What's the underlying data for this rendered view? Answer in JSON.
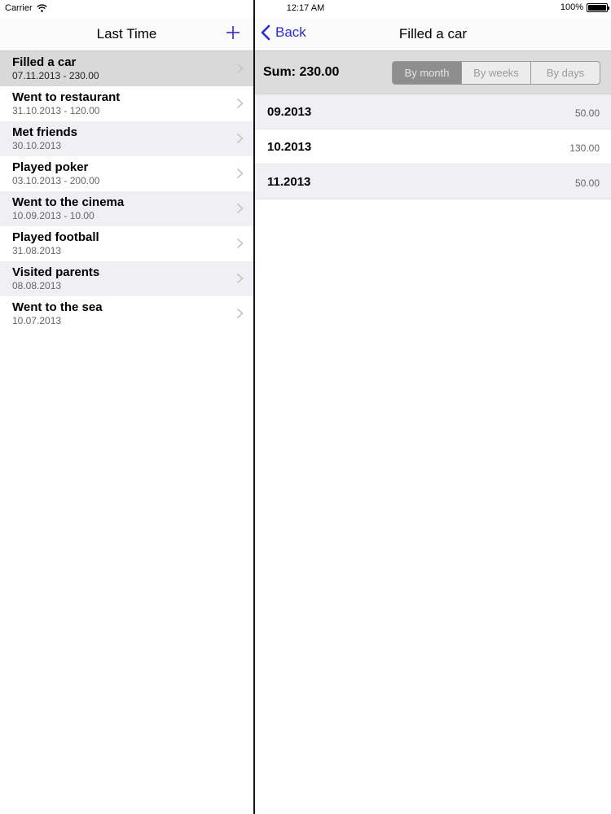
{
  "status": {
    "carrier": "Carrier",
    "time": "12:17 AM",
    "battery": "100%"
  },
  "master": {
    "title": "Last Time",
    "items": [
      {
        "title": "Filled a car",
        "subtitle": "07.11.2013 - 230.00"
      },
      {
        "title": "Went to restaurant",
        "subtitle": "31.10.2013 - 120.00"
      },
      {
        "title": "Met friends",
        "subtitle": "30.10.2013"
      },
      {
        "title": "Played poker",
        "subtitle": "03.10.2013 - 200.00"
      },
      {
        "title": "Went to the cinema",
        "subtitle": "10.09.2013 - 10.00"
      },
      {
        "title": "Played football",
        "subtitle": "31.08.2013"
      },
      {
        "title": "Visited parents",
        "subtitle": "08.08.2013"
      },
      {
        "title": "Went to the sea",
        "subtitle": "10.07.2013"
      }
    ]
  },
  "detail": {
    "back_label": "Back",
    "title": "Filled a car",
    "sum": "Sum: 230.00",
    "segments": [
      "By month",
      "By weeks",
      "By days"
    ],
    "active_segment": "By month",
    "rows": [
      {
        "period": "09.2013",
        "amount": "50.00"
      },
      {
        "period": "10.2013",
        "amount": "130.00"
      },
      {
        "period": "11.2013",
        "amount": "50.00"
      }
    ]
  },
  "colors": {
    "tint": "#2b2bd4",
    "selected_row": "#d9d9d9",
    "alt_row": "#efeff4",
    "sum_bar": "#dcdcdc"
  }
}
